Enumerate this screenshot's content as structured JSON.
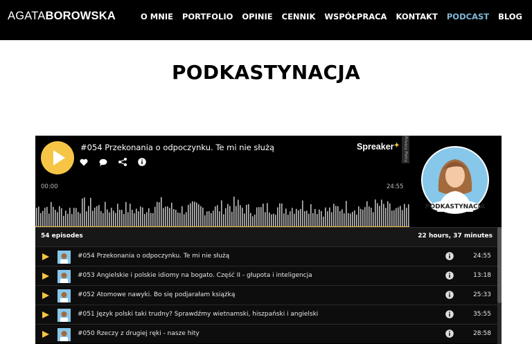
{
  "header": {
    "logo_part1": "AGATA",
    "logo_part2": "BOROWSKA",
    "nav": [
      "O MNIE",
      "PORTFOLIO",
      "OPINIE",
      "CENNIK",
      "WSPÓŁPRACA",
      "KONTAKT",
      "PODCAST",
      "BLOG"
    ],
    "active_nav": "PODCAST"
  },
  "page": {
    "title": "PODKASTYNACJA"
  },
  "player": {
    "current_title": "#054 Przekonania o odpoczynku. Te mi nie służą",
    "brand": "Spreaker",
    "privacy": "Privacy Policy",
    "time_current": "00:00",
    "time_total": "24:55",
    "progress": 0,
    "cover_text": "PODKASTYNACJA",
    "episodes_count": "54 episodes",
    "total_duration": "22 hours, 37 minutes",
    "episodes": [
      {
        "title": "#054 Przekonania o odpoczynku. Te mi nie służą",
        "duration": "24:55"
      },
      {
        "title": "#053 Angielskie i polskie idiomy na bogato. Część II - głupota i inteligencja",
        "duration": "13:18"
      },
      {
        "title": "#052 Atomowe nawyki. Bo się podjarałam książką",
        "duration": "25:33"
      },
      {
        "title": "#051 Język polski taki trudny? Sprawdźmy wietnamski, hiszpański i angielski",
        "duration": "35:55"
      },
      {
        "title": "#050 Rzeczy z drugiej ręki - nasze hity",
        "duration": "28:58"
      }
    ]
  },
  "colors": {
    "accent": "#f6c546",
    "nav_active": "#7fb8d8",
    "background": "#000000"
  },
  "icons": [
    "heart-icon",
    "comment-icon",
    "share-icon",
    "info-icon",
    "play-icon"
  ]
}
